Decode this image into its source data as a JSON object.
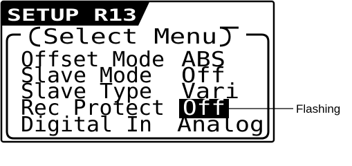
{
  "header": {
    "title": "SETUP R13"
  },
  "menu": {
    "title": "Select Menu",
    "rows": [
      {
        "label": "Offset Mode",
        "value": "ABS"
      },
      {
        "label": "Slave Mode",
        "value": "Off"
      },
      {
        "label": "Slave Type",
        "value": "Vari"
      },
      {
        "label": "Rec Protect",
        "value": "Off",
        "highlighted": true
      },
      {
        "label": "Digital In",
        "value": "Analog"
      }
    ]
  },
  "callout": {
    "label": "Flashing"
  }
}
